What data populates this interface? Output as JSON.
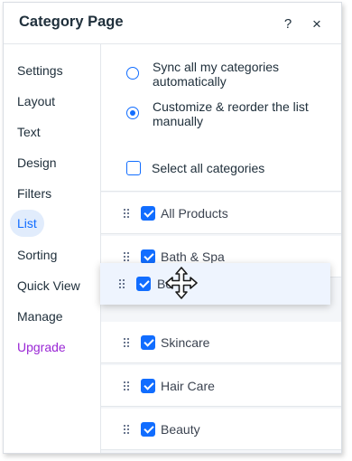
{
  "header": {
    "title": "Category Page",
    "help_label": "?",
    "close_label": "×"
  },
  "sidebar": {
    "items": [
      {
        "label": "Settings"
      },
      {
        "label": "Layout"
      },
      {
        "label": "Text"
      },
      {
        "label": "Design"
      },
      {
        "label": "Filters"
      },
      {
        "label": "List",
        "active": true
      },
      {
        "label": "Sorting"
      },
      {
        "label": "Quick View"
      },
      {
        "label": "Manage"
      },
      {
        "label": "Upgrade",
        "upgrade": true
      }
    ]
  },
  "options": {
    "sync_line1": "Sync all my categories",
    "sync_line2": "automatically",
    "customize_line1": "Customize & reorder the list",
    "customize_line2": "manually",
    "selected": "customize",
    "select_all_label": "Select all categories",
    "select_all_checked": false
  },
  "list": {
    "rows": [
      {
        "label": "All Products",
        "checked": true
      },
      {
        "label": "Bath & Spa",
        "checked": true
      },
      {
        "label": "Skincare",
        "checked": true
      },
      {
        "label": "Hair Care",
        "checked": true
      },
      {
        "label": "Beauty",
        "checked": true
      }
    ],
    "dragging": {
      "label": "Bo",
      "checked": true
    }
  },
  "icons": {
    "drag": "drag-handle-icon",
    "move_cursor": "move-cursor-icon"
  },
  "colors": {
    "accent": "#116dff",
    "active_nav_bg": "#e1ecfc",
    "upgrade": "#9a27d5",
    "content_bg": "#f4f6f9",
    "drag_row_bg": "#eef4fe"
  }
}
